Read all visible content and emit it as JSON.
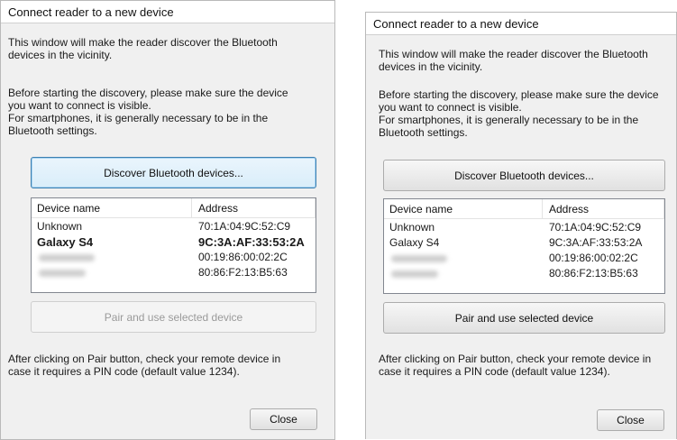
{
  "dialogs": [
    {
      "title": "Connect reader to a new device",
      "intro": [
        "This window will make the reader discover the Bluetooth",
        "devices in the vicinity."
      ],
      "before": [
        "Before starting the discovery, please make sure the device",
        "you want to connect is visible.",
        "For smartphones, it is generally necessary to be in the",
        "Bluetooth settings."
      ],
      "discover_button": "Discover Bluetooth devices...",
      "list": {
        "columns": [
          "Device name",
          "Address"
        ],
        "rows": [
          {
            "name": "Unknown",
            "address": "70:1A:04:9C:52:C9"
          },
          {
            "name": "Galaxy S4",
            "address": "9C:3A:AF:33:53:2A"
          },
          {
            "name": "",
            "address": "00:19:86:00:02:2C"
          },
          {
            "name": "",
            "address": "80:86:F2:13:B5:63"
          }
        ]
      },
      "pair_button": "Pair and use selected device",
      "after": [
        "After clicking on Pair button, check your remote device in",
        "case it requires a PIN code (default value 1234)."
      ],
      "close_button": "Close"
    },
    {
      "title": "Connect reader to a new device",
      "intro": [
        "This window will make the reader discover the Bluetooth",
        "devices in the vicinity."
      ],
      "before": [
        "Before starting the discovery, please make sure the device",
        "you want to connect is visible.",
        "For smartphones, it is generally necessary to be in the",
        "Bluetooth settings."
      ],
      "discover_button": "Discover Bluetooth devices...",
      "list": {
        "columns": [
          "Device name",
          "Address"
        ],
        "rows": [
          {
            "name": "Unknown",
            "address": "70:1A:04:9C:52:C9"
          },
          {
            "name": "Galaxy S4",
            "address": "9C:3A:AF:33:53:2A"
          },
          {
            "name": "",
            "address": "00:19:86:00:02:2C"
          },
          {
            "name": "",
            "address": "80:86:F2:13:B5:63"
          }
        ]
      },
      "pair_button": "Pair and use selected device",
      "after": [
        "After clicking on Pair button, check your remote device in",
        "case it requires a PIN code (default value 1234)."
      ],
      "close_button": "Close"
    }
  ]
}
